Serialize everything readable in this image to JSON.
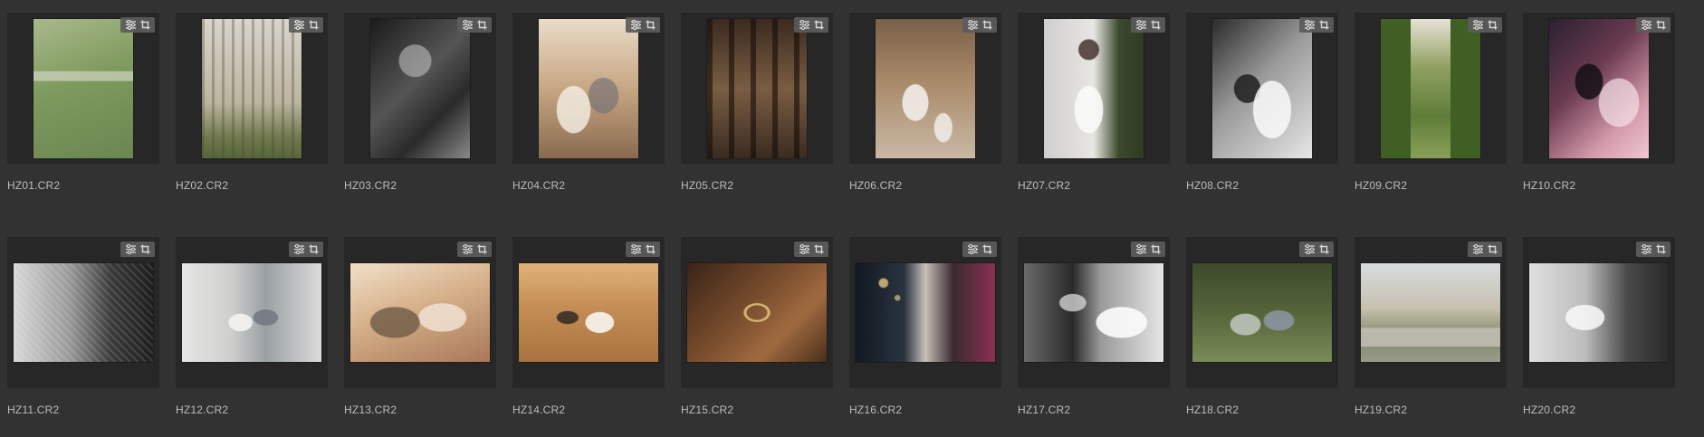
{
  "filmstrip": {
    "items": [
      {
        "filename": "HZ01.CR2",
        "orientation": "portrait",
        "bg": "linear-gradient(160deg,#a9b98a 0%,#7e9a5e 45%,#6b8650 100%)",
        "detail": "linear-gradient(0deg, transparent 55%, rgba(230,230,220,0.55) 56%, rgba(230,230,220,0.55) 62%, transparent 63%)"
      },
      {
        "filename": "HZ02.CR2",
        "orientation": "portrait",
        "bg": "linear-gradient(180deg,#d9d5cc 0%,#bcb59f 60%,#6f7a4e 85%,#56663a 100%)",
        "detail": "repeating-linear-gradient(90deg, rgba(80,70,60,0.35) 0 3px, transparent 3px 11px)"
      },
      {
        "filename": "HZ03.CR2",
        "orientation": "portrait",
        "bg": "linear-gradient(135deg,#1a1a1a 0%,#555 45%,#2a2a2a 70%,#8a8a8a 100%)",
        "detail": "radial-gradient(circle at 45% 30%, rgba(200,200,200,0.55) 0 14%, transparent 15%)"
      },
      {
        "filename": "HZ04.CR2",
        "orientation": "portrait",
        "bg": "linear-gradient(180deg,#e9dcc8 0%,#c7a683 50%,#8a6a4f 100%)",
        "detail": "radial-gradient(ellipse at 35% 65%, rgba(245,240,230,0.8) 0 18%, transparent 19%), radial-gradient(ellipse at 65% 55%, rgba(120,115,120,0.7) 0 16%, transparent 17%)"
      },
      {
        "filename": "HZ05.CR2",
        "orientation": "portrait",
        "bg": "linear-gradient(180deg,#3b2a1f 0%,#7a5d42 50%,#3a2b20 100%)",
        "detail": "repeating-linear-gradient(90deg, rgba(20,12,8,0.6) 0 6px, transparent 6px 24px)"
      },
      {
        "filename": "HZ06.CR2",
        "orientation": "portrait",
        "bg": "linear-gradient(180deg,#7a6048 0%,#a98a6a 45%,#c9b8a4 100%)",
        "detail": "radial-gradient(ellipse at 40% 60%, rgba(245,242,238,0.85) 0 15%, transparent 16%), radial-gradient(ellipse at 68% 78%, rgba(245,242,238,0.8) 0 9%, transparent 10%)"
      },
      {
        "filename": "HZ07.CR2",
        "orientation": "portrait",
        "bg": "linear-gradient(90deg,#cfcfcf 0%,#e8e6e2 50%,#3d4a2e 75%,#2e3a22 100%)",
        "detail": "radial-gradient(ellipse at 45% 65%, rgba(250,250,248,0.9) 0 18%, transparent 19%), radial-gradient(circle at 45% 22%, rgba(60,40,35,0.8) 0 8%, transparent 9%)"
      },
      {
        "filename": "HZ08.CR2",
        "orientation": "portrait",
        "bg": "linear-gradient(135deg,#2a2a2a 0%,#9a9a9a 45%,#e6e6e6 100%)",
        "detail": "radial-gradient(ellipse at 60% 65%, rgba(250,250,250,0.85) 0 22%, transparent 23%), radial-gradient(ellipse at 35% 50%, rgba(30,30,30,0.85) 0 14%, transparent 15%)"
      },
      {
        "filename": "HZ09.CR2",
        "orientation": "portrait",
        "bg": "linear-gradient(180deg,#e8e2d6 0%,#8fa060 35%,#5f7d38 70%,#8aa05a 100%)",
        "detail": "linear-gradient(90deg, #3f5f24 0 30%, transparent 30% 70%, #3f5f24 70% 100%)"
      },
      {
        "filename": "HZ10.CR2",
        "orientation": "portrait",
        "bg": "linear-gradient(135deg,#2b2030 0%,#6a3a50 40%,#d49aaa 75%,#eec8d2 100%)",
        "detail": "radial-gradient(ellipse at 40% 45%, rgba(20,15,20,0.85) 0 16%, transparent 17%), radial-gradient(ellipse at 70% 60%, rgba(245,225,232,0.7) 0 20%, transparent 21%)"
      },
      {
        "filename": "HZ11.CR2",
        "orientation": "landscape",
        "bg": "linear-gradient(90deg,#d8d8d8 0%,#9a9a9a 40%,#3a3a3a 70%,#1e1e1e 100%)",
        "detail": "repeating-linear-gradient(45deg, rgba(255,255,255,0.12) 0 2px, transparent 2px 6px)"
      },
      {
        "filename": "HZ12.CR2",
        "orientation": "landscape",
        "bg": "linear-gradient(90deg,#e6e6e4 0%,#cfcfcc 35%,#9aa0a4 60%,#dcdcda 100%)",
        "detail": "radial-gradient(ellipse at 42% 60%, rgba(245,244,242,0.9) 0 10%, transparent 11%), radial-gradient(ellipse at 60% 55%, rgba(110,115,125,0.8) 0 10%, transparent 11%)"
      },
      {
        "filename": "HZ13.CR2",
        "orientation": "landscape",
        "bg": "linear-gradient(160deg,#f0e0c8 0%,#d6b08a 45%,#a87858 100%)",
        "detail": "radial-gradient(ellipse at 32% 60%, rgba(110,90,70,0.8) 0 18%, transparent 19%), radial-gradient(ellipse at 66% 55%, rgba(240,225,210,0.85) 0 18%, transparent 19%)"
      },
      {
        "filename": "HZ14.CR2",
        "orientation": "landscape",
        "bg": "linear-gradient(180deg,#e0b27a 0%,#c48d55 45%,#a8733f 100%)",
        "detail": "radial-gradient(ellipse at 35% 55%, rgba(50,40,35,0.85) 0 8%, transparent 9%), radial-gradient(ellipse at 58% 60%, rgba(250,246,240,0.9) 0 12%, transparent 13%)"
      },
      {
        "filename": "HZ15.CR2",
        "orientation": "landscape",
        "bg": "linear-gradient(135deg,#3a2416 0%,#7a4e2e 45%,#a06a40 70%,#4a2e1a 100%)",
        "detail": "radial-gradient(ellipse at 50% 50%, transparent 0 10%, rgba(220,190,120,0.9) 11% 13%, transparent 14%)"
      },
      {
        "filename": "HZ16.CR2",
        "orientation": "landscape",
        "bg": "linear-gradient(90deg,#101820 0%,#2a3440 35%,#c8c0b8 50%,#3a2a30 70%,#8a3050 100%)",
        "detail": "radial-gradient(circle at 20% 20%, rgba(255,220,140,0.7) 0 3%, transparent 4%), radial-gradient(circle at 30% 35%, rgba(255,220,140,0.6) 0 2%, transparent 3%)"
      },
      {
        "filename": "HZ17.CR2",
        "orientation": "landscape",
        "bg": "linear-gradient(90deg,#6a6a6a 0%,#2a2a2a 35%,#9a9a9a 55%,#e6e6e6 100%)",
        "detail": "radial-gradient(ellipse at 35% 40%, rgba(230,230,230,0.7) 0 10%, transparent 11%), radial-gradient(ellipse at 70% 60%, rgba(252,252,252,0.9) 0 18%, transparent 19%)"
      },
      {
        "filename": "HZ18.CR2",
        "orientation": "landscape",
        "bg": "linear-gradient(180deg,#3e4a2c 0%,#55653a 50%,#7a8a58 100%)",
        "detail": "radial-gradient(ellipse at 38% 62%, rgba(200,205,200,0.8) 0 12%, transparent 13%), radial-gradient(ellipse at 62% 58%, rgba(140,150,165,0.85) 0 12%, transparent 13%)"
      },
      {
        "filename": "HZ19.CR2",
        "orientation": "landscape",
        "bg": "linear-gradient(180deg,#d6dde0 0%,#c8c0ae 45%,#7f8a6a 75%,#9a9a8a 100%)",
        "detail": "linear-gradient(0deg, transparent 15%, rgba(200,195,185,0.8) 16% 34%, transparent 35%)"
      },
      {
        "filename": "HZ20.CR2",
        "orientation": "landscape",
        "bg": "linear-gradient(90deg,#e0e0e0 0%,#bcbcbc 40%,#4a4a4a 70%,#2a2a2a 100%)",
        "detail": "radial-gradient(ellipse at 40% 55%, rgba(250,250,250,0.85) 0 16%, transparent 17%)"
      }
    ]
  }
}
